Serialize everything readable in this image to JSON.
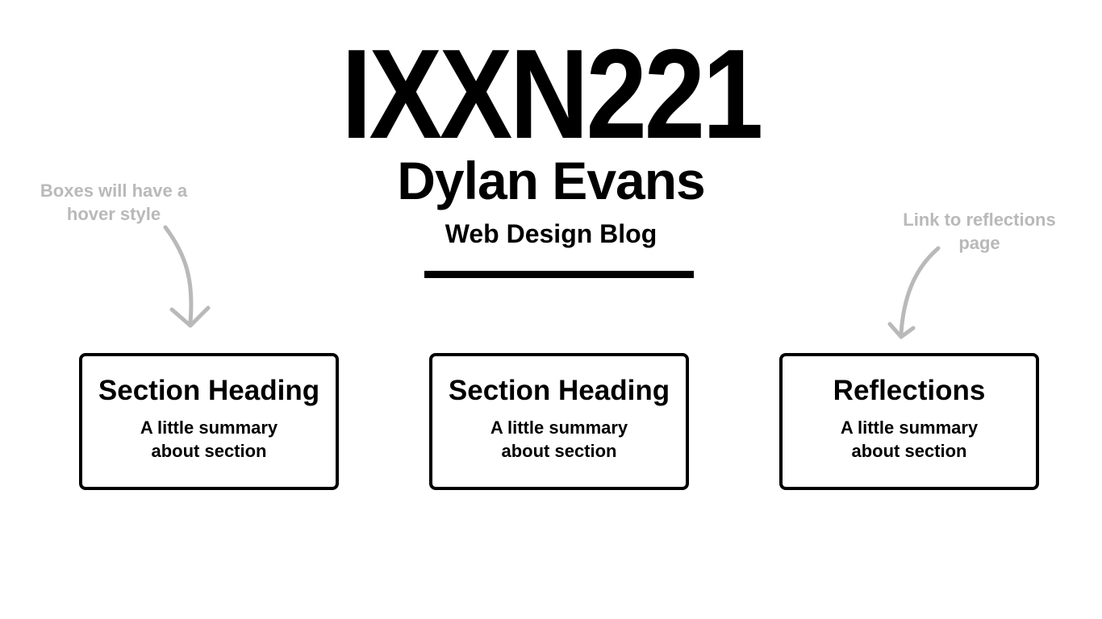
{
  "header": {
    "title": "IXXN221",
    "author": "Dylan Evans",
    "tagline": "Web Design Blog"
  },
  "annotations": {
    "left_note": "Boxes will have a hover style",
    "right_note": "Link to reflections page",
    "color": "#b9b9b9"
  },
  "sections": [
    {
      "heading": "Section Heading",
      "summary": "A little summary about section"
    },
    {
      "heading": "Section Heading",
      "summary": "A little summary about section"
    },
    {
      "heading": "Reflections",
      "summary": "A little summary about section"
    }
  ]
}
